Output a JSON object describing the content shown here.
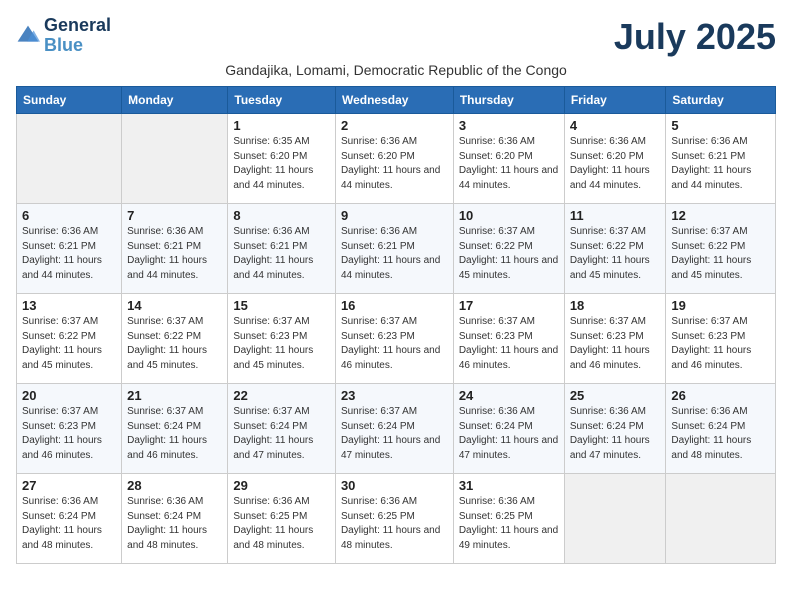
{
  "header": {
    "logo_line1": "General",
    "logo_line2": "Blue",
    "month_title": "July 2025",
    "subtitle": "Gandajika, Lomami, Democratic Republic of the Congo"
  },
  "weekdays": [
    "Sunday",
    "Monday",
    "Tuesday",
    "Wednesday",
    "Thursday",
    "Friday",
    "Saturday"
  ],
  "weeks": [
    [
      {
        "day": "",
        "info": ""
      },
      {
        "day": "",
        "info": ""
      },
      {
        "day": "1",
        "info": "Sunrise: 6:35 AM\nSunset: 6:20 PM\nDaylight: 11 hours and 44 minutes."
      },
      {
        "day": "2",
        "info": "Sunrise: 6:36 AM\nSunset: 6:20 PM\nDaylight: 11 hours and 44 minutes."
      },
      {
        "day": "3",
        "info": "Sunrise: 6:36 AM\nSunset: 6:20 PM\nDaylight: 11 hours and 44 minutes."
      },
      {
        "day": "4",
        "info": "Sunrise: 6:36 AM\nSunset: 6:20 PM\nDaylight: 11 hours and 44 minutes."
      },
      {
        "day": "5",
        "info": "Sunrise: 6:36 AM\nSunset: 6:21 PM\nDaylight: 11 hours and 44 minutes."
      }
    ],
    [
      {
        "day": "6",
        "info": "Sunrise: 6:36 AM\nSunset: 6:21 PM\nDaylight: 11 hours and 44 minutes."
      },
      {
        "day": "7",
        "info": "Sunrise: 6:36 AM\nSunset: 6:21 PM\nDaylight: 11 hours and 44 minutes."
      },
      {
        "day": "8",
        "info": "Sunrise: 6:36 AM\nSunset: 6:21 PM\nDaylight: 11 hours and 44 minutes."
      },
      {
        "day": "9",
        "info": "Sunrise: 6:36 AM\nSunset: 6:21 PM\nDaylight: 11 hours and 44 minutes."
      },
      {
        "day": "10",
        "info": "Sunrise: 6:37 AM\nSunset: 6:22 PM\nDaylight: 11 hours and 45 minutes."
      },
      {
        "day": "11",
        "info": "Sunrise: 6:37 AM\nSunset: 6:22 PM\nDaylight: 11 hours and 45 minutes."
      },
      {
        "day": "12",
        "info": "Sunrise: 6:37 AM\nSunset: 6:22 PM\nDaylight: 11 hours and 45 minutes."
      }
    ],
    [
      {
        "day": "13",
        "info": "Sunrise: 6:37 AM\nSunset: 6:22 PM\nDaylight: 11 hours and 45 minutes."
      },
      {
        "day": "14",
        "info": "Sunrise: 6:37 AM\nSunset: 6:22 PM\nDaylight: 11 hours and 45 minutes."
      },
      {
        "day": "15",
        "info": "Sunrise: 6:37 AM\nSunset: 6:23 PM\nDaylight: 11 hours and 45 minutes."
      },
      {
        "day": "16",
        "info": "Sunrise: 6:37 AM\nSunset: 6:23 PM\nDaylight: 11 hours and 46 minutes."
      },
      {
        "day": "17",
        "info": "Sunrise: 6:37 AM\nSunset: 6:23 PM\nDaylight: 11 hours and 46 minutes."
      },
      {
        "day": "18",
        "info": "Sunrise: 6:37 AM\nSunset: 6:23 PM\nDaylight: 11 hours and 46 minutes."
      },
      {
        "day": "19",
        "info": "Sunrise: 6:37 AM\nSunset: 6:23 PM\nDaylight: 11 hours and 46 minutes."
      }
    ],
    [
      {
        "day": "20",
        "info": "Sunrise: 6:37 AM\nSunset: 6:23 PM\nDaylight: 11 hours and 46 minutes."
      },
      {
        "day": "21",
        "info": "Sunrise: 6:37 AM\nSunset: 6:24 PM\nDaylight: 11 hours and 46 minutes."
      },
      {
        "day": "22",
        "info": "Sunrise: 6:37 AM\nSunset: 6:24 PM\nDaylight: 11 hours and 47 minutes."
      },
      {
        "day": "23",
        "info": "Sunrise: 6:37 AM\nSunset: 6:24 PM\nDaylight: 11 hours and 47 minutes."
      },
      {
        "day": "24",
        "info": "Sunrise: 6:36 AM\nSunset: 6:24 PM\nDaylight: 11 hours and 47 minutes."
      },
      {
        "day": "25",
        "info": "Sunrise: 6:36 AM\nSunset: 6:24 PM\nDaylight: 11 hours and 47 minutes."
      },
      {
        "day": "26",
        "info": "Sunrise: 6:36 AM\nSunset: 6:24 PM\nDaylight: 11 hours and 48 minutes."
      }
    ],
    [
      {
        "day": "27",
        "info": "Sunrise: 6:36 AM\nSunset: 6:24 PM\nDaylight: 11 hours and 48 minutes."
      },
      {
        "day": "28",
        "info": "Sunrise: 6:36 AM\nSunset: 6:24 PM\nDaylight: 11 hours and 48 minutes."
      },
      {
        "day": "29",
        "info": "Sunrise: 6:36 AM\nSunset: 6:25 PM\nDaylight: 11 hours and 48 minutes."
      },
      {
        "day": "30",
        "info": "Sunrise: 6:36 AM\nSunset: 6:25 PM\nDaylight: 11 hours and 48 minutes."
      },
      {
        "day": "31",
        "info": "Sunrise: 6:36 AM\nSunset: 6:25 PM\nDaylight: 11 hours and 49 minutes."
      },
      {
        "day": "",
        "info": ""
      },
      {
        "day": "",
        "info": ""
      }
    ]
  ]
}
